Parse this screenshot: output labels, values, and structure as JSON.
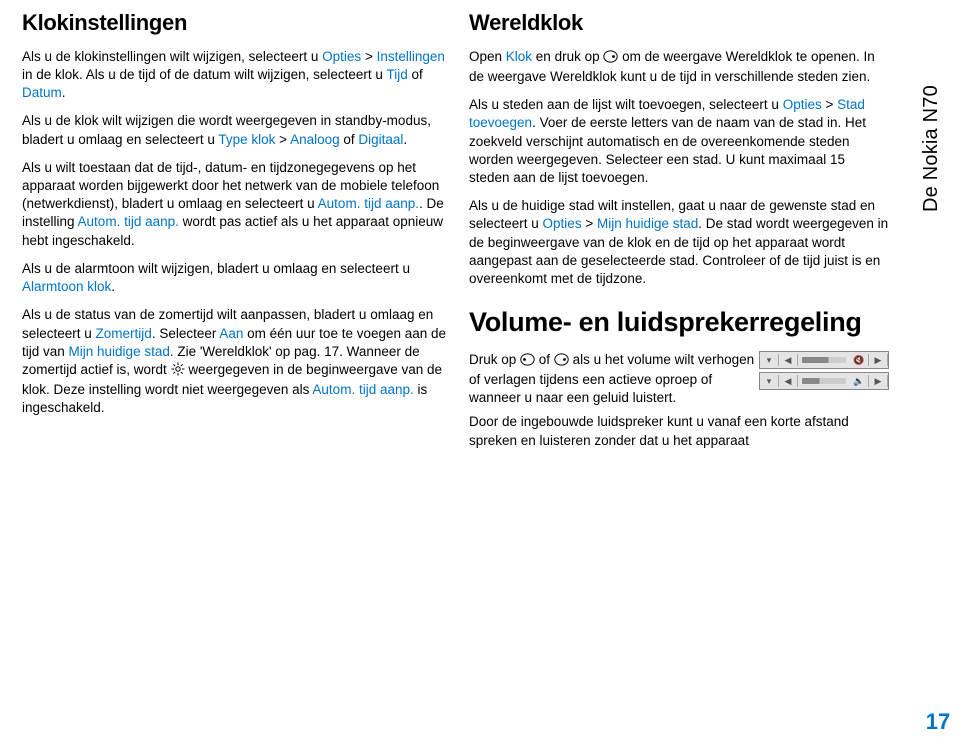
{
  "side_tab": "De Nokia N70",
  "page_number": "17",
  "left": {
    "h_klok": "Klokinstellingen",
    "p1_a": "Als u de klokinstellingen wilt wijzigen, selecteert u ",
    "p1_hl1": "Opties",
    "p1_b": " > ",
    "p1_hl2": "Instellingen",
    "p1_c": " in de klok. Als u de tijd of de datum wilt wijzigen, selecteert u ",
    "p1_hl3": "Tijd",
    "p1_d": " of ",
    "p1_hl4": "Datum",
    "p1_e": ".",
    "p2_a": "Als u de klok wilt wijzigen die wordt weergegeven in standby-modus, bladert u omlaag en selecteert u ",
    "p2_hl1": "Type klok",
    "p2_b": " > ",
    "p2_hl2": "Analoog",
    "p2_c": " of ",
    "p2_hl3": "Digitaal",
    "p2_d": ".",
    "p3_a": "Als u wilt toestaan dat de tijd-, datum- en tijdzonegegevens op het apparaat worden bijgewerkt door het netwerk van de mobiele telefoon (netwerkdienst), bladert u omlaag en selecteert u ",
    "p3_hl1": "Autom. tijd aanp.",
    "p3_b": ". De instelling ",
    "p3_hl2": "Autom. tijd aanp.",
    "p3_c": " wordt pas actief als u het apparaat opnieuw hebt ingeschakeld.",
    "p4_a": "Als u de alarmtoon wilt wijzigen, bladert u omlaag en selecteert u ",
    "p4_hl1": "Alarmtoon klok",
    "p4_b": ".",
    "p5_a": "Als u de status van de zomertijd wilt aanpassen, bladert u omlaag en selecteert u ",
    "p5_hl1": "Zomertijd",
    "p5_b": ". Selecteer ",
    "p5_hl2": "Aan",
    "p5_c": " om één uur toe te voegen aan de tijd van ",
    "p5_hl3": "Mijn huidige stad",
    "p5_d": ". Zie 'Wereldklok' op pag. 17. Wanneer de zomertijd actief is, wordt ",
    "p5_e": " weergegeven in de beginweergave van de klok. Deze instelling wordt niet weergegeven als ",
    "p5_hl4": "Autom. tijd aanp.",
    "p5_f": " is ingeschakeld."
  },
  "right": {
    "h_wereld": "Wereldklok",
    "p1_a": "Open ",
    "p1_hl1": "Klok",
    "p1_b": " en druk op ",
    "p1_c": " om de weergave Wereldklok te openen. In de weergave Wereldklok kunt u de tijd in verschillende steden zien.",
    "p2_a": "Als u steden aan de lijst wilt toevoegen, selecteert u ",
    "p2_hl1": "Opties",
    "p2_b": " > ",
    "p2_hl2": "Stad toevoegen",
    "p2_c": ". Voer de eerste letters van de naam van de stad in. Het zoekveld verschijnt automatisch en de overeenkomende steden worden weergegeven. Selecteer een stad. U kunt maximaal 15 steden aan de lijst toevoegen.",
    "p3_a": "Als u de huidige stad wilt instellen, gaat u naar de gewenste stad en selecteert u ",
    "p3_hl1": "Opties",
    "p3_b": " > ",
    "p3_hl2": "Mijn huidige stad",
    "p3_c": ". De stad wordt weergegeven in de beginweergave van de klok en de tijd op het apparaat wordt aangepast aan de geselecteerde stad. Controleer of de tijd juist is en overeenkomt met de tijdzone.",
    "h_volume": "Volume- en luidsprekerregeling",
    "p4_a": "Druk op ",
    "p4_b": " of ",
    "p4_c": " als u het volume wilt verhogen of verlagen tijdens een actieve oproep of wanneer u naar een geluid luistert.",
    "p5": "Door de ingebouwde luidspreker kunt u vanaf een korte afstand spreken en luisteren zonder dat u het apparaat"
  }
}
